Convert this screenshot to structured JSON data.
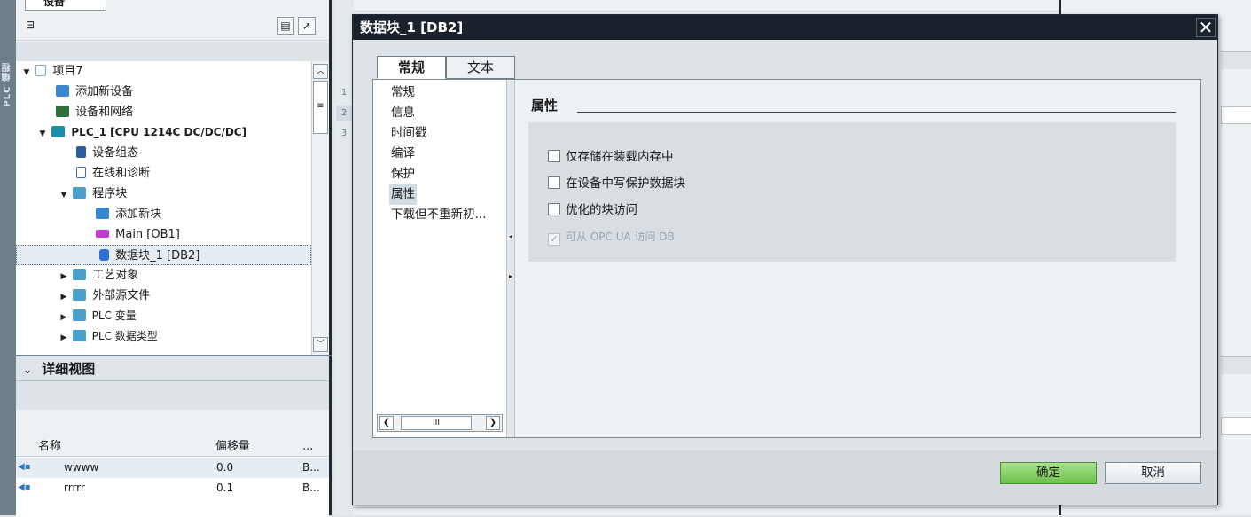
{
  "left_strip": {
    "label": "PLC 编程"
  },
  "project_tree": {
    "tab_label": "设备",
    "rows": [
      {
        "label": "项目7",
        "twisty": "▼"
      },
      {
        "label": "添加新设备",
        "twisty": ""
      },
      {
        "label": "设备和网络",
        "twisty": ""
      },
      {
        "label": "PLC_1 [CPU 1214C DC/DC/DC]",
        "twisty": "▼"
      },
      {
        "label": "设备组态",
        "twisty": ""
      },
      {
        "label": "在线和诊断",
        "twisty": ""
      },
      {
        "label": "程序块",
        "twisty": "▼"
      },
      {
        "label": "添加新块",
        "twisty": ""
      },
      {
        "label": "Main [OB1]",
        "twisty": ""
      },
      {
        "label": "数据块_1 [DB2]",
        "twisty": ""
      },
      {
        "label": "工艺对象",
        "twisty": "▶"
      },
      {
        "label": "外部源文件",
        "twisty": "▶"
      },
      {
        "label": "PLC 变量",
        "twisty": "▶"
      },
      {
        "label": "PLC 数据类型",
        "twisty": "▶"
      }
    ],
    "selected_row": "数据块_1 [DB2]"
  },
  "details_view": {
    "title": "详细视图",
    "columns": [
      "名称",
      "偏移量",
      "..."
    ],
    "rows": [
      {
        "name": "wwww",
        "offset": "0.0",
        "type": "B..."
      },
      {
        "name": "rrrrr",
        "offset": "0.1",
        "type": "B..."
      }
    ]
  },
  "gutter": {
    "line_numbers": [
      "1",
      "2",
      "3"
    ]
  },
  "dialog": {
    "title": "数据块_1 [DB2]",
    "close_glyph": "✕",
    "tabs": [
      {
        "label": "常规",
        "active": true
      },
      {
        "label": "文本",
        "active": false
      }
    ],
    "nav_items": [
      "常规",
      "信息",
      "时间戳",
      "编译",
      "保护",
      "属性",
      "下载但不重新初..."
    ],
    "active_nav": "属性",
    "section_title": "属性",
    "options": [
      {
        "label": "仅存储在装载内存中",
        "checked": false,
        "enabled": true
      },
      {
        "label": "在设备中写保护数据块",
        "checked": false,
        "enabled": true
      },
      {
        "label": "优化的块访问",
        "checked": false,
        "enabled": true
      },
      {
        "label": "可从 OPC UA 访问 DB",
        "checked": true,
        "enabled": false
      }
    ],
    "ok_label": "确定",
    "cancel_label": "取消"
  },
  "colors": {
    "title_bar": "#1a222b",
    "ok_button": "#6cc14a",
    "panel_bg": "#eef1f4"
  }
}
